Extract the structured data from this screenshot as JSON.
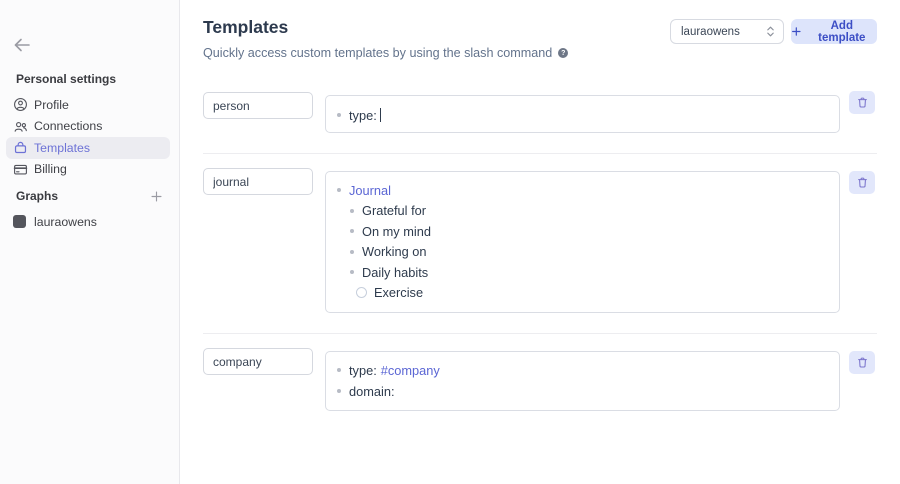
{
  "colors": {
    "accent": "#5b66d4",
    "button_bg": "#dde4fb",
    "button_text": "#3c4ec5",
    "selected_bg": "#ececf1",
    "selected_text": "#6d72d6"
  },
  "sidebar": {
    "personal_settings_label": "Personal settings",
    "items": [
      {
        "label": "Profile",
        "icon": "profile-icon",
        "selected": false
      },
      {
        "label": "Connections",
        "icon": "connections-icon",
        "selected": false
      },
      {
        "label": "Templates",
        "icon": "templates-icon",
        "selected": true
      },
      {
        "label": "Billing",
        "icon": "billing-icon",
        "selected": false
      }
    ],
    "graphs_label": "Graphs",
    "graphs": [
      {
        "label": "lauraowens",
        "icon": "graph-icon"
      }
    ]
  },
  "header": {
    "title": "Templates",
    "subtitle": "Quickly access custom templates by using the slash command",
    "graph_select_value": "lauraowens",
    "add_button_label": "Add template"
  },
  "templates": [
    {
      "name": "person",
      "blocks": [
        {
          "text": "type:",
          "has_cursor": true
        }
      ]
    },
    {
      "name": "journal",
      "root": "Journal",
      "children": [
        "Grateful for",
        "On my mind",
        "Working on",
        "Daily habits"
      ],
      "todo_item": "Exercise"
    },
    {
      "name": "company",
      "blocks": [
        {
          "text": "type:",
          "tag": "#company"
        },
        {
          "text": "domain:"
        }
      ]
    }
  ]
}
